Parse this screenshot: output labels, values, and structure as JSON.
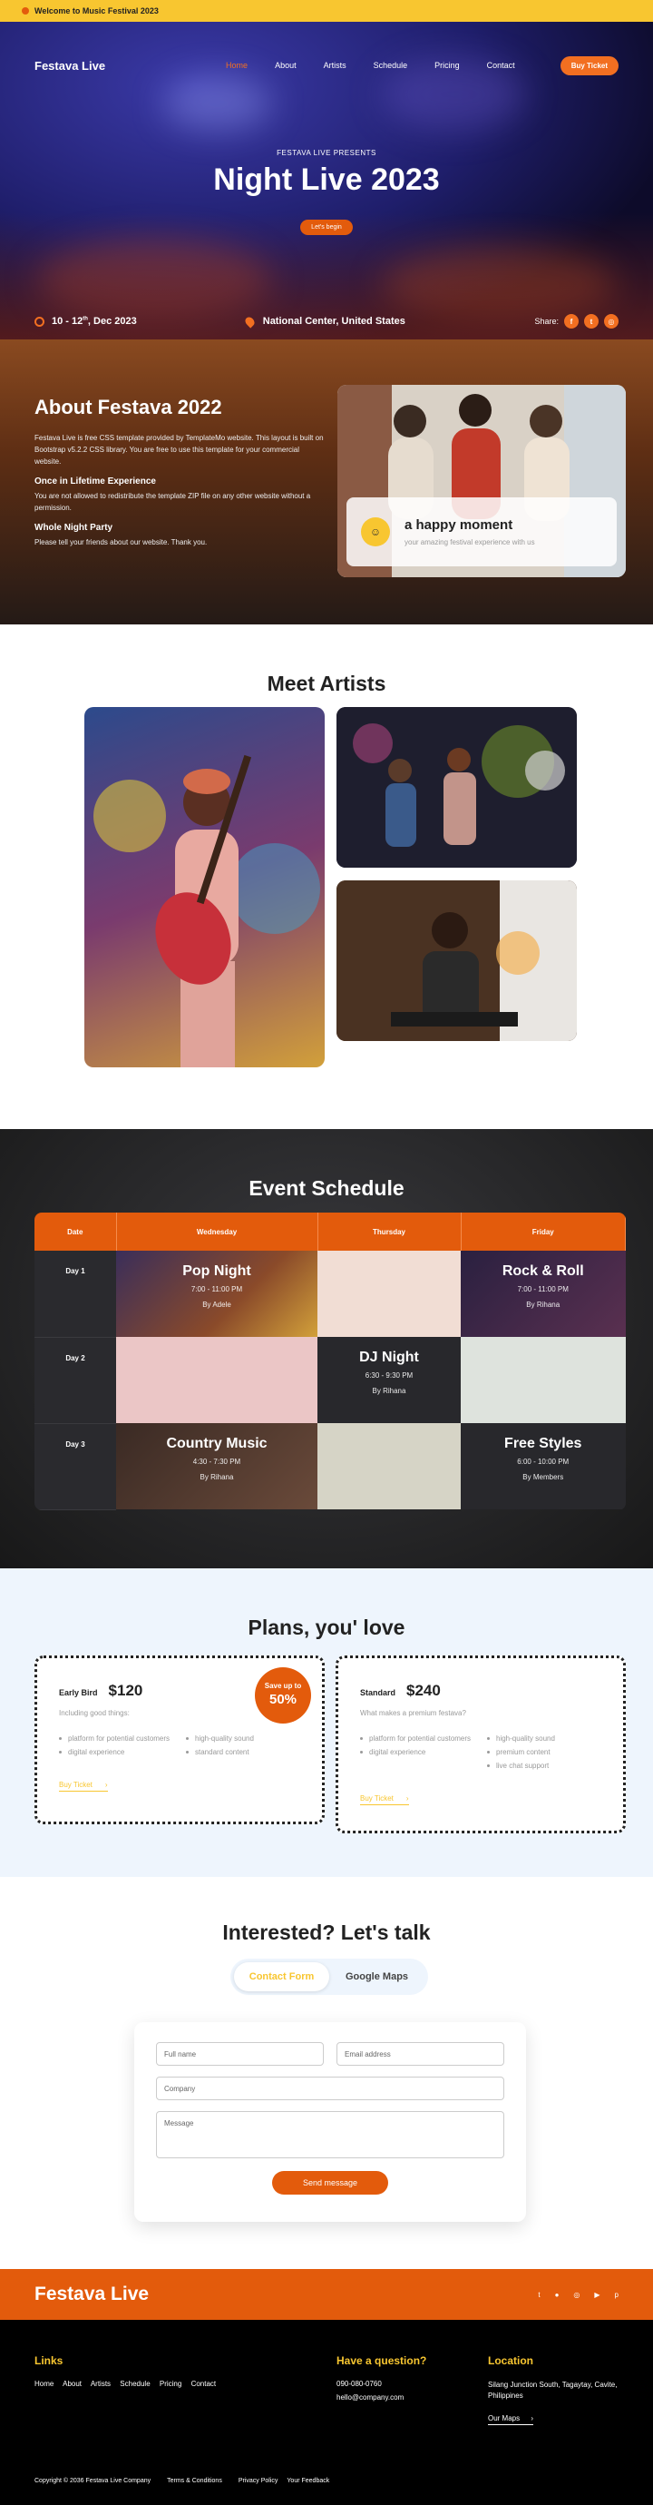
{
  "topbar": {
    "text": "Welcome to Music Festival 2023"
  },
  "nav": {
    "brand": "Festava Live",
    "links": [
      "Home",
      "About",
      "Artists",
      "Schedule",
      "Pricing",
      "Contact"
    ],
    "ticket": "Buy Ticket"
  },
  "hero": {
    "kicker": "FESTAVA LIVE PRESENTS",
    "title": "Night Live 2023",
    "cta": "Let's begin",
    "date_pre": "10 - 12",
    "date_sup": "th",
    "date_post": ", Dec 2023",
    "venue": "National Center, United States",
    "share": "Share:"
  },
  "about": {
    "title": "About Festava 2022",
    "intro": "Festava Live is free CSS template provided by TemplateMo website. This layout is built on Bootstrap v5.2.2 CSS library. You are free to use this template for your commercial website.",
    "h1": "Once in Lifetime Experience",
    "p1": "You are not allowed to redistribute the template ZIP file on any other website without a permission.",
    "h2": "Whole Night Party",
    "p2": "Please tell your friends about our website. Thank you.",
    "card_title": "a happy moment",
    "card_text": "your amazing festival experience with us"
  },
  "artists": {
    "title": "Meet Artists"
  },
  "schedule": {
    "title": "Event Schedule",
    "headers": [
      "Date",
      "Wednesday",
      "Thursday",
      "Friday"
    ],
    "days": [
      "Day 1",
      "Day 2",
      "Day 3"
    ],
    "events": {
      "pop": {
        "name": "Pop Night",
        "time": "7:00 - 11:00 PM",
        "by": "By Adele"
      },
      "rock": {
        "name": "Rock & Roll",
        "time": "7:00 - 11:00 PM",
        "by": "By Rihana"
      },
      "dj": {
        "name": "DJ Night",
        "time": "6:30 - 9:30 PM",
        "by": "By Rihana"
      },
      "country": {
        "name": "Country Music",
        "time": "4:30 - 7:30 PM",
        "by": "By Rihana"
      },
      "free": {
        "name": "Free Styles",
        "time": "6:00 - 10:00 PM",
        "by": "By Members"
      }
    }
  },
  "plans": {
    "title": "Plans, you' love",
    "early": {
      "name": "Early Bird",
      "price": "$120",
      "sub": "Including good things:",
      "features": [
        "platform for potential customers",
        "high-quality sound",
        "digital experience",
        "standard content"
      ],
      "buy": "Buy Ticket",
      "badge_top": "Save up to",
      "badge_val": "50%"
    },
    "standard": {
      "name": "Standard",
      "price": "$240",
      "sub": "What makes a premium festava?",
      "features": [
        "platform for potential customers",
        "high-quality sound",
        "digital experience",
        "premium content",
        "live chat support"
      ],
      "buy": "Buy Ticket"
    }
  },
  "contact": {
    "title": "Interested? Let's talk",
    "tabs": [
      "Contact Form",
      "Google Maps"
    ],
    "full_name": "Full name",
    "email": "Email address",
    "company": "Company",
    "message": "Message",
    "send": "Send message"
  },
  "footer": {
    "brand": "Festava Live",
    "links_title": "Links",
    "links": [
      "Home",
      "About",
      "Artists",
      "Schedule",
      "Pricing",
      "Contact"
    ],
    "question_title": "Have a question?",
    "phone": "090-080-0760",
    "email": "hello@company.com",
    "location_title": "Location",
    "address": "Silang Junction South, Tagaytay, Cavite, Philippines",
    "maps": "Our Maps",
    "copyright": "Copyright © 2036 Festava Live Company",
    "legal": [
      "Terms & Conditions",
      "Privacy Policy",
      "Your Feedback"
    ]
  },
  "colors": {
    "accent": "#e35b0c",
    "yellow": "#f8c630"
  },
  "icons": [
    "music-icon",
    "clock-icon",
    "location-icon",
    "facebook-icon",
    "twitter-icon",
    "instagram-icon",
    "user-icon",
    "arrow-right-icon",
    "youtube-icon",
    "pinterest-icon",
    "apple-icon"
  ]
}
